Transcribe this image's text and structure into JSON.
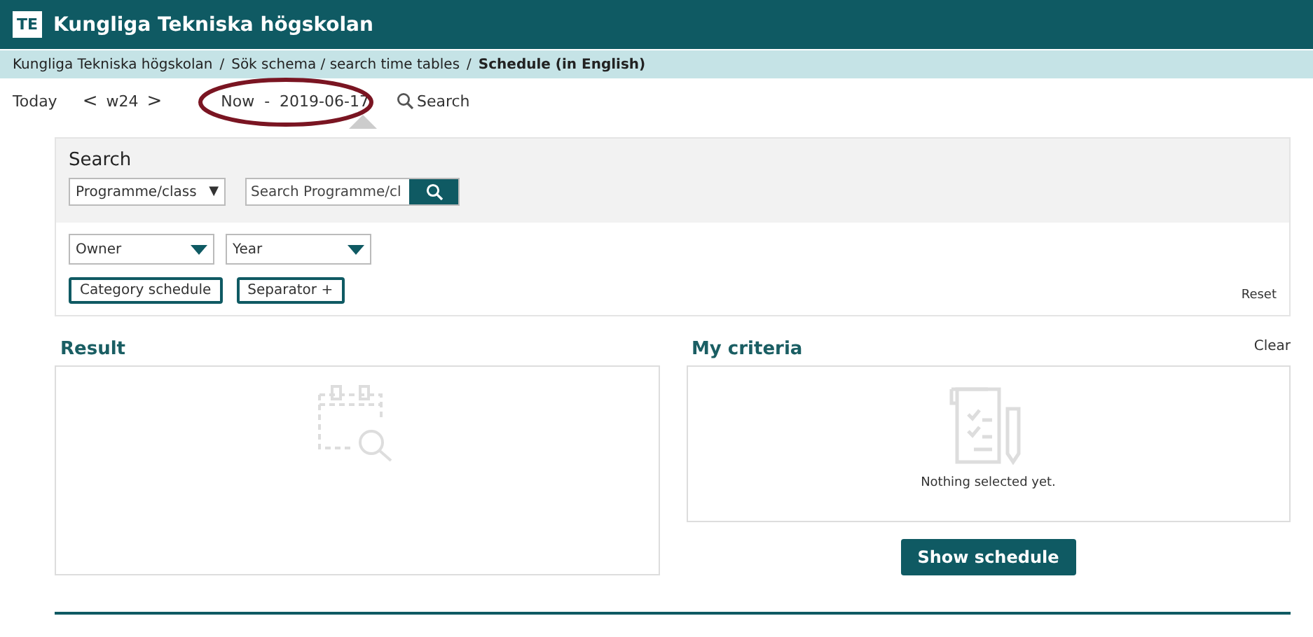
{
  "header": {
    "logo": "TE",
    "title": "Kungliga Tekniska högskolan"
  },
  "breadcrumbs": [
    {
      "label": "Kungliga Tekniska högskolan",
      "current": false
    },
    {
      "label": "Sök schema / search time tables",
      "current": false
    },
    {
      "label": "Schedule (in English)",
      "current": true
    }
  ],
  "breadcrumb_separator": "/",
  "toolbar": {
    "today": "Today",
    "prev": "<",
    "week": "w24",
    "next": ">",
    "range": "Now  -  2019-06-17",
    "search": "Search",
    "range_highlighted": true
  },
  "search_panel": {
    "title": "Search",
    "type_select": "Programme/class",
    "type_select_arrow": "▼",
    "search_field": {
      "placeholder": "Search Programme/cl"
    },
    "filters": [
      "Owner",
      "Year"
    ],
    "buttons": [
      "Category schedule",
      "Separator +"
    ],
    "reset": "Reset"
  },
  "result": {
    "title": "Result"
  },
  "criteria": {
    "title": "My criteria",
    "clear": "Clear",
    "empty_text": "Nothing selected yet."
  },
  "show_button": "Show schedule"
}
